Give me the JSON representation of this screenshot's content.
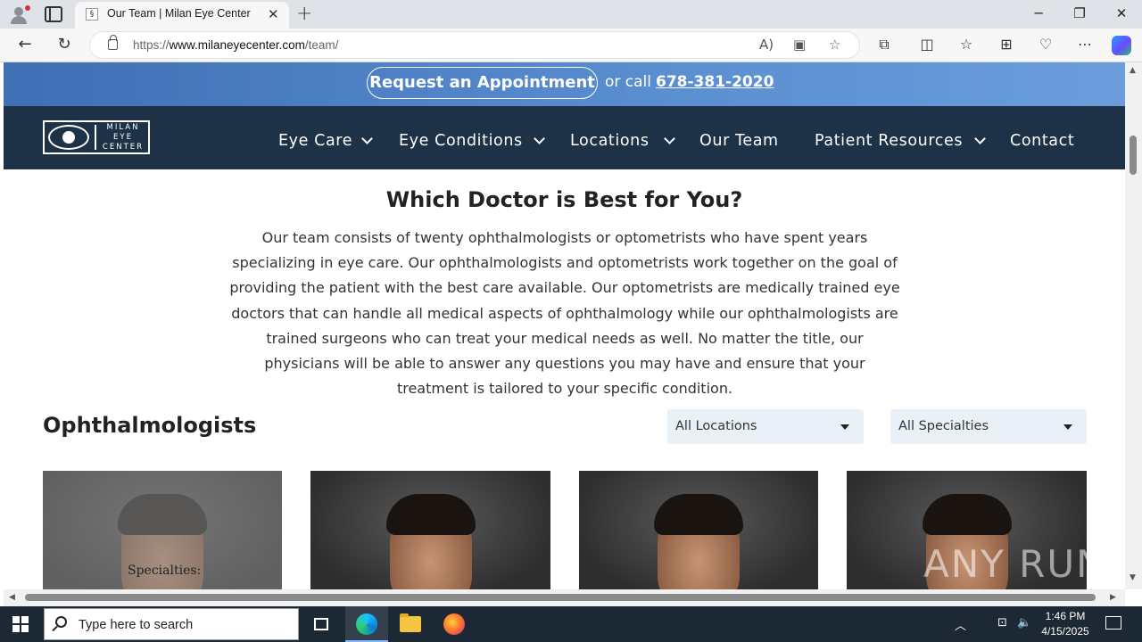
{
  "browser": {
    "tab_title": "Our Team | Milan Eye Center",
    "tab_favicon": "§",
    "new_tab_glyph": "+",
    "tab_close_glyph": "✕",
    "url_prefix": "https://",
    "url_host": "www.milaneyecenter.com",
    "url_path": "/team/",
    "window_buttons": [
      "─",
      "❐",
      "✕"
    ],
    "nav_glyphs": {
      "back": "←",
      "refresh": "↻"
    },
    "omni_icons": {
      "read_aloud": "A)",
      "immersive_reader": "▣",
      "favorite": "☆"
    },
    "tool_icons": {
      "extensions": "⧉",
      "split_screen": "◫",
      "favorites": "☆",
      "collections": "⊞",
      "browser_essentials": "♡",
      "more": "⋯"
    }
  },
  "promo": {
    "appointment_label": "Request an Appointment",
    "or_call": "or call",
    "phone": "678-381-2020"
  },
  "logo": {
    "line1": "MILAN",
    "line2": "EYE",
    "line3": "CENTER"
  },
  "nav": {
    "items": [
      {
        "label": "Eye Care",
        "has_dropdown": true
      },
      {
        "label": "Eye Conditions",
        "has_dropdown": true
      },
      {
        "label": "Locations",
        "has_dropdown": true
      },
      {
        "label": "Our Team",
        "has_dropdown": false
      },
      {
        "label": "Patient Resources",
        "has_dropdown": true
      },
      {
        "label": "Contact",
        "has_dropdown": false
      }
    ]
  },
  "intro": {
    "heading": "Which Doctor is Best for You?",
    "text": "Our team consists of twenty ophthalmologists or optometrists who have spent years specializing in eye care. Our ophthalmologists and optometrists work together on the goal of providing the patient with the best care available. Our optometrists are medically trained eye doctors that can handle all medical aspects of ophthalmology while our ophthalmologists are trained surgeons who can treat your medical needs as well. No matter the title, our physicians will be able to answer any questions you may have and ensure that your treatment is tailored to your specific condition."
  },
  "section": {
    "title": "Ophthalmologists",
    "filters": {
      "location_selected": "All Locations",
      "specialty_selected": "All Specialties"
    }
  },
  "doctor_cards": {
    "hovered_overlay_label": "Specialties:"
  },
  "watermark": "ANY RUN",
  "taskbar": {
    "search_placeholder": "Type here to search",
    "time": "1:46 PM",
    "date": "4/15/2025",
    "tray_icons": {
      "chevron": "︿",
      "network": "⊡",
      "volume": "🔈"
    }
  },
  "colors": {
    "promo_blue": "#4a7cc1",
    "nav_navy": "#1d3247",
    "filter_bg": "#eaf0f8"
  }
}
